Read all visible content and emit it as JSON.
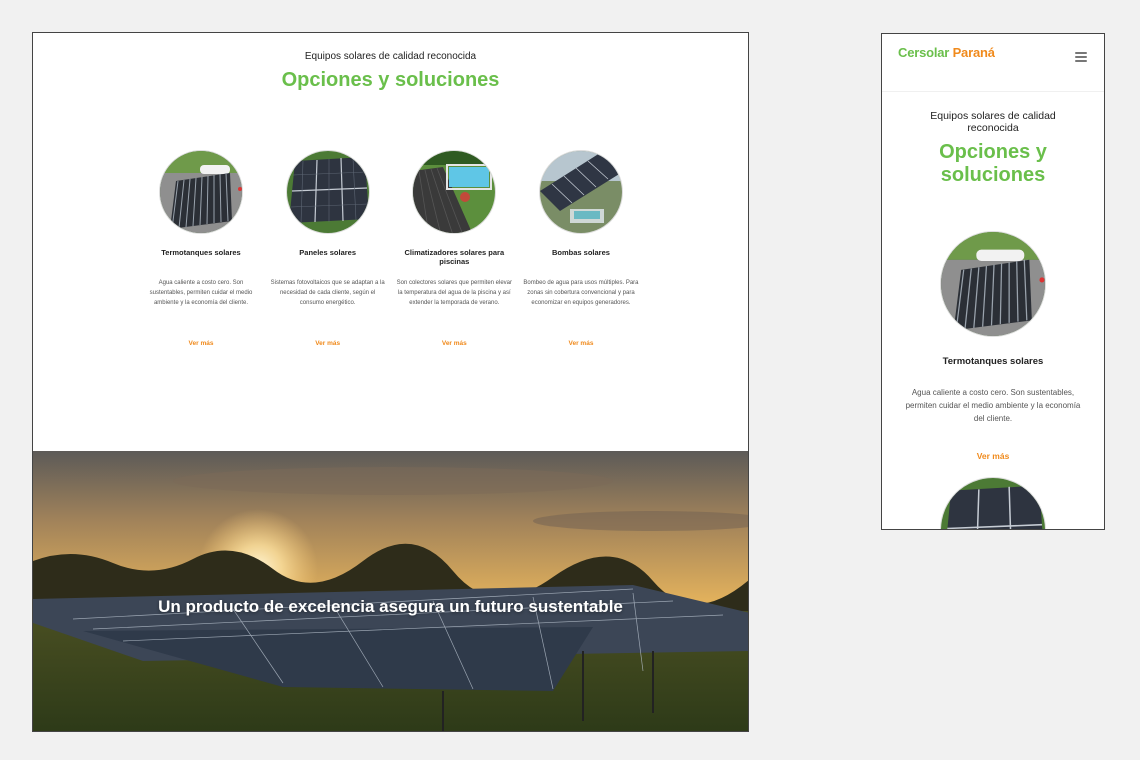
{
  "desktop": {
    "kicker": "Equipos solares de calidad reconocida",
    "title": "Opciones y soluciones",
    "products": [
      {
        "image": "solar-water-heater-image",
        "title": "Termotanques solares",
        "text": "Agua caliente a costo cero. Son sustentables, permiten cuidar el medio ambiente y la economía del cliente.",
        "link": "Ver más"
      },
      {
        "image": "solar-panels-image",
        "title": "Paneles solares",
        "text": "Sistemas fotovoltaicos que se adaptan a la necesidad de cada cliente, según el consumo energético.",
        "link": "Ver más"
      },
      {
        "image": "pool-heater-image",
        "title": "Climatizadores solares para piscinas",
        "text": "Son colectores solares que permiten elevar la temperatura del agua de la piscina y así extender la temporada de verano.",
        "link": "Ver más"
      },
      {
        "image": "water-pump-image",
        "title": "Bombas solares",
        "text": "Bombeo de agua para usos múltiples. Para zonas sin cobertura convencional y para economizar en equipos generadores.",
        "link": "Ver más"
      }
    ],
    "hero_text": "Un producto de excelencia asegura un futuro sustentable"
  },
  "mobile": {
    "logo_main": "Cersolar",
    "logo_accent": "Paraná",
    "menu_icon": "hamburger-menu-icon",
    "kicker": "Equipos solares de calidad reconocida",
    "title": "Opciones y soluciones",
    "product": {
      "title": "Termotanques solares",
      "text": "Agua caliente a costo cero. Son sustentables, permiten cuidar el medio ambiente y la economía del cliente.",
      "link": "Ver más"
    }
  },
  "colors": {
    "brand_green": "#6abf4b",
    "accent_orange": "#f08a1c"
  }
}
